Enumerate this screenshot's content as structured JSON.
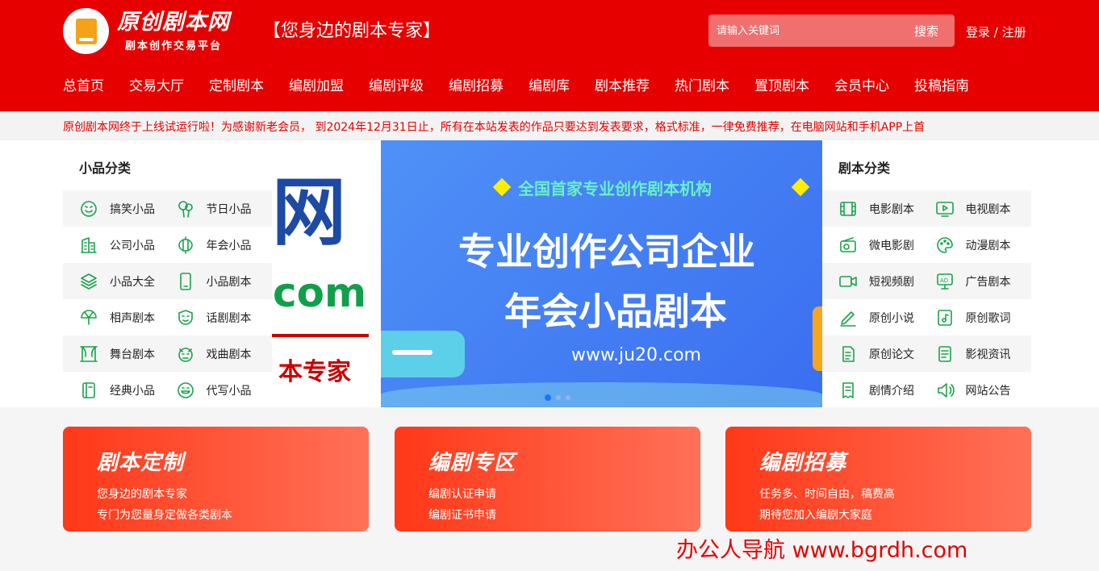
{
  "header": {
    "logo_title": "原创剧本网",
    "logo_subtitle": "剧本创作交易平台",
    "slogan": "【您身边的剧本专家】",
    "search_placeholder": "请输入关键词",
    "search_button": "搜索",
    "login": "登录",
    "separator": " / ",
    "register": "注册"
  },
  "nav": [
    "总首页",
    "交易大厅",
    "定制剧本",
    "编剧加盟",
    "编剧评级",
    "编剧招募",
    "编剧库",
    "剧本推荐",
    "热门剧本",
    "置顶剧本",
    "会员中心",
    "投稿指南"
  ],
  "ticker": "原创剧本网终于上线试运行啦！为感谢新老会员， 到2024年12月31日止，所有在本站发表的作品只要达到发表要求，格式标准，一律免费推荐，在电脑网站和手机APP上首",
  "left_panel": {
    "title": "小品分类",
    "rows": [
      [
        {
          "label": "搞笑小品",
          "icon": "smile-icon"
        },
        {
          "label": "节日小品",
          "icon": "balloon-icon"
        }
      ],
      [
        {
          "label": "公司小品",
          "icon": "building-icon"
        },
        {
          "label": "年会小品",
          "icon": "lantern-icon"
        }
      ],
      [
        {
          "label": "小品大全",
          "icon": "layers-icon"
        },
        {
          "label": "小品剧本",
          "icon": "phone-icon"
        }
      ],
      [
        {
          "label": "相声剧本",
          "icon": "fan-icon"
        },
        {
          "label": "话剧剧本",
          "icon": "mask-icon"
        }
      ],
      [
        {
          "label": "舞台剧本",
          "icon": "stage-icon"
        },
        {
          "label": "戏曲剧本",
          "icon": "opera-icon"
        }
      ],
      [
        {
          "label": "经典小品",
          "icon": "book-icon"
        },
        {
          "label": "代写小品",
          "icon": "grin-icon"
        }
      ]
    ]
  },
  "right_panel": {
    "title": "剧本分类",
    "rows": [
      [
        {
          "label": "电影剧本",
          "icon": "film-icon"
        },
        {
          "label": "电视剧本",
          "icon": "tv-icon"
        }
      ],
      [
        {
          "label": "微电影剧",
          "icon": "radio-icon"
        },
        {
          "label": "动漫剧本",
          "icon": "palette-icon"
        }
      ],
      [
        {
          "label": "短视频剧",
          "icon": "video-icon"
        },
        {
          "label": "广告剧本",
          "icon": "ad-icon"
        }
      ],
      [
        {
          "label": "原创小说",
          "icon": "pen-icon"
        },
        {
          "label": "原创歌词",
          "icon": "music-icon"
        }
      ],
      [
        {
          "label": "原创论文",
          "icon": "doc-icon"
        },
        {
          "label": "影视资讯",
          "icon": "news-icon"
        }
      ],
      [
        {
          "label": "剧情介绍",
          "icon": "scroll-icon"
        },
        {
          "label": "网站公告",
          "icon": "speaker-icon"
        }
      ]
    ]
  },
  "banner": {
    "left_big": "本网",
    "left_com": ".com",
    "left_sub": "本专家",
    "top_text": "全国首家专业创作剧本机构",
    "line1": "专业创作公司企业",
    "line2": "年会小品剧本",
    "url": "www.ju20.com",
    "dot_count": 3,
    "active_dot": 0
  },
  "cards": [
    {
      "title": "剧本定制",
      "line1": "您身边的剧本专家",
      "line2": "专门为您量身定做各类剧本"
    },
    {
      "title": "编剧专区",
      "line1": "编剧认证申请",
      "line2": "编剧证书申请"
    },
    {
      "title": "编剧招募",
      "line1": "任务多、时间自由，稿费高",
      "line2": "期待您加入编剧大家庭"
    }
  ],
  "watermark": "办公人导航 www.bgrdh.com",
  "colors": {
    "brand_red": "#e60000",
    "icon_green": "#19a34a",
    "card_start": "#ff3818",
    "card_end": "#ff7158"
  }
}
